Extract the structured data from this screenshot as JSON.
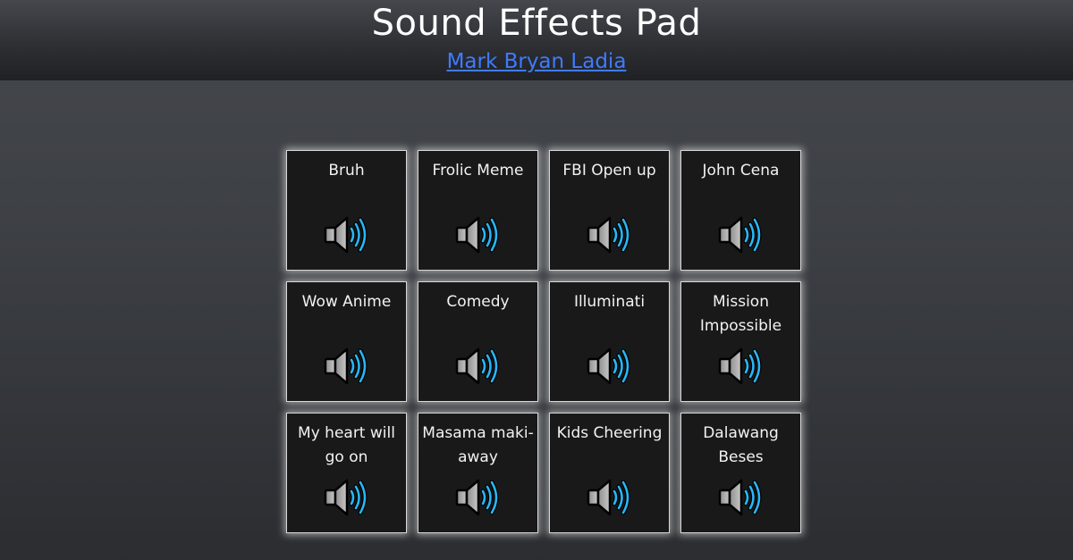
{
  "header": {
    "title": "Sound Effects Pad",
    "author_link": "Mark Bryan Ladia"
  },
  "pads": [
    {
      "label": "Bruh",
      "icon": "speaker-icon"
    },
    {
      "label": "Frolic Meme",
      "icon": "speaker-icon"
    },
    {
      "label": "FBI Open up",
      "icon": "speaker-icon"
    },
    {
      "label": "John Cena",
      "icon": "speaker-icon"
    },
    {
      "label": "Wow Anime",
      "icon": "speaker-icon"
    },
    {
      "label": "Comedy",
      "icon": "speaker-icon"
    },
    {
      "label": "Illuminati",
      "icon": "speaker-icon"
    },
    {
      "label": "Mission Impossible",
      "icon": "speaker-icon"
    },
    {
      "label": "My heart will go on",
      "icon": "speaker-icon"
    },
    {
      "label": "Masama maki-away",
      "icon": "speaker-icon"
    },
    {
      "label": "Kids Cheering",
      "icon": "speaker-icon"
    },
    {
      "label": "Dalawang Beses",
      "icon": "speaker-icon"
    }
  ],
  "colors": {
    "link": "#3f7bff",
    "pad_background": "#19191a",
    "sound_waves": "#29b6f6"
  }
}
